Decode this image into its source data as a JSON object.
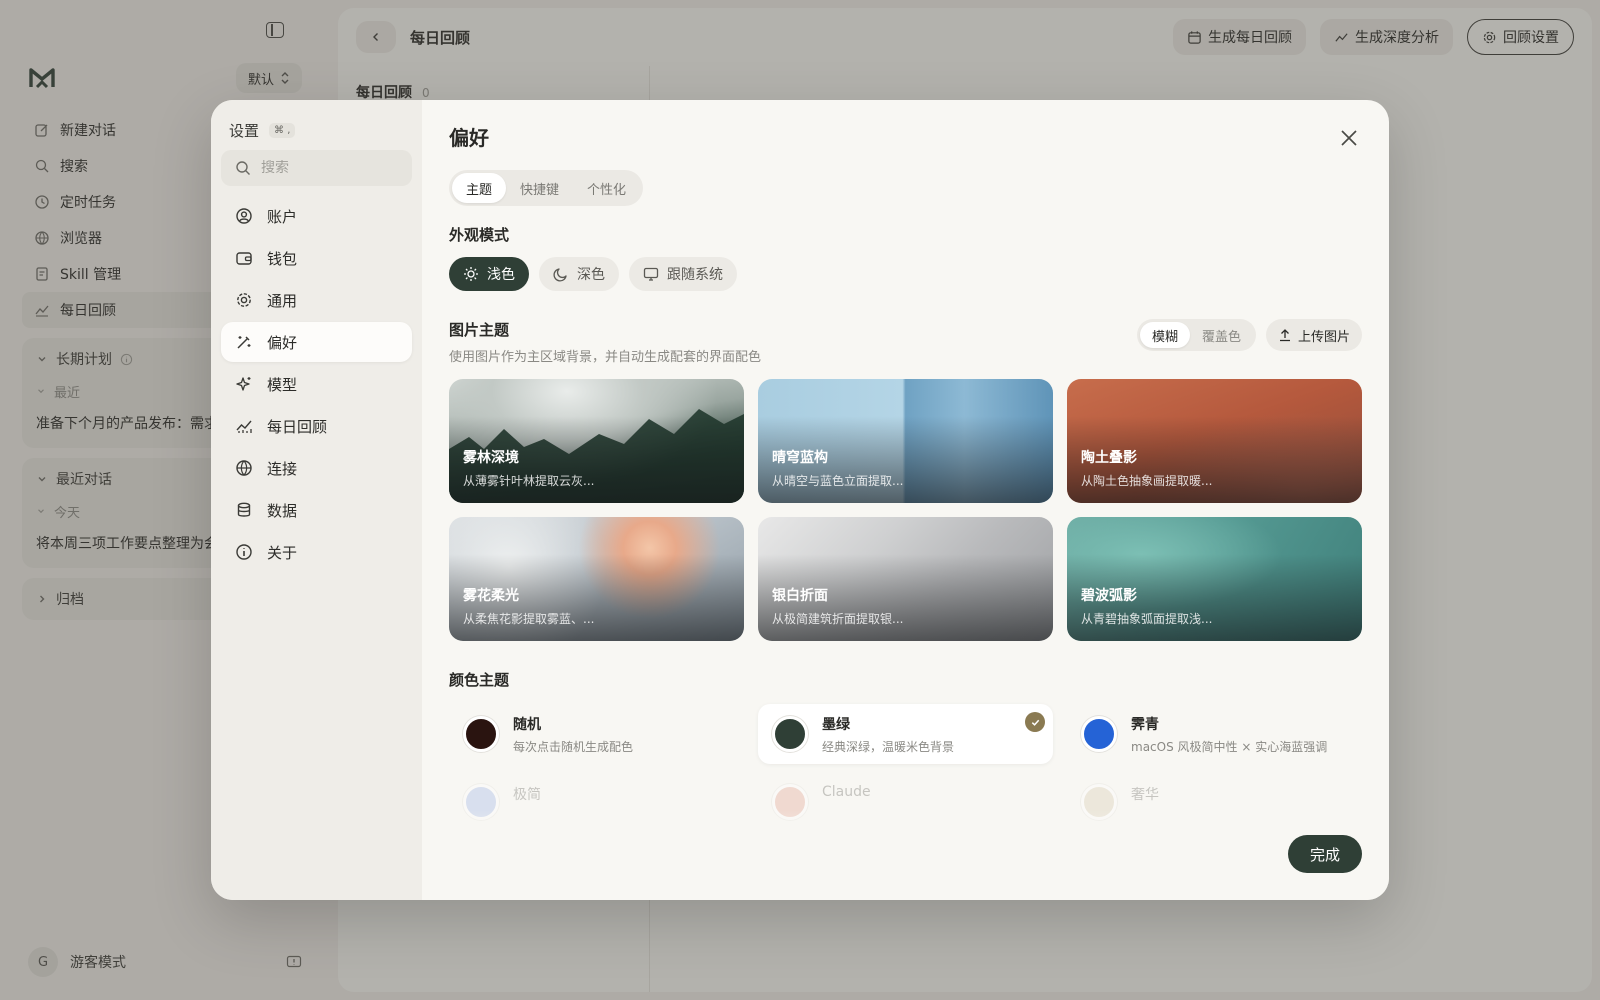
{
  "app": {
    "workspace_select": "默认",
    "nav": [
      {
        "label": "新建对话",
        "icon": "edit-icon"
      },
      {
        "label": "搜索",
        "icon": "search-icon"
      },
      {
        "label": "定时任务",
        "icon": "clock-icon"
      },
      {
        "label": "浏览器",
        "icon": "globe-icon"
      },
      {
        "label": "Skill 管理",
        "icon": "skill-icon"
      },
      {
        "label": "每日回顾",
        "icon": "chart-icon"
      }
    ],
    "sections": {
      "long_term": {
        "label": "长期计划",
        "sub": "最近",
        "item": "准备下个月的产品发布：需求"
      },
      "recent": {
        "label": "最近对话",
        "sub": "今天",
        "item": "将本周三项工作要点整理为会"
      },
      "archive": {
        "label": "归档"
      }
    },
    "footer": {
      "avatar": "G",
      "name": "游客模式"
    }
  },
  "main": {
    "title": "每日回顾",
    "buttons": {
      "generate_daily": "生成每日回顾",
      "generate_deep": "生成深度分析",
      "settings": "回顾设置"
    },
    "list_header": "每日回顾",
    "list_count": "0"
  },
  "modal": {
    "sidebar_title": "设置",
    "shortcut": "⌘ ,",
    "search_placeholder": "搜索",
    "nav": [
      {
        "label": "账户",
        "icon": "user-icon"
      },
      {
        "label": "钱包",
        "icon": "wallet-icon"
      },
      {
        "label": "通用",
        "icon": "gear-icon"
      },
      {
        "label": "偏好",
        "icon": "wand-icon"
      },
      {
        "label": "模型",
        "icon": "sparkle-icon"
      },
      {
        "label": "每日回顾",
        "icon": "chart-icon"
      },
      {
        "label": "连接",
        "icon": "globe-icon"
      },
      {
        "label": "数据",
        "icon": "database-icon"
      },
      {
        "label": "关于",
        "icon": "info-icon"
      }
    ],
    "active_nav": "偏好",
    "title": "偏好",
    "tabs": [
      "主题",
      "快捷键",
      "个性化"
    ],
    "active_tab": "主题",
    "appearance": {
      "label": "外观模式",
      "options": [
        "浅色",
        "深色",
        "跟随系统"
      ],
      "selected": "浅色"
    },
    "image_theme": {
      "label": "图片主题",
      "description": "使用图片作为主区域背景，并自动生成配套的界面配色",
      "modes": [
        "模糊",
        "覆盖色"
      ],
      "selected_mode": "模糊",
      "upload": "上传图片",
      "cards": [
        {
          "title": "雾林深境",
          "desc": "从薄雾针叶林提取云灰..."
        },
        {
          "title": "晴穹蓝构",
          "desc": "从晴空与蓝色立面提取..."
        },
        {
          "title": "陶土叠影",
          "desc": "从陶土色抽象画提取暖..."
        },
        {
          "title": "雾花柔光",
          "desc": "从柔焦花影提取雾蓝、..."
        },
        {
          "title": "银白折面",
          "desc": "从极简建筑折面提取银..."
        },
        {
          "title": "碧波弧影",
          "desc": "从青碧抽象弧面提取浅..."
        }
      ]
    },
    "color_theme": {
      "label": "颜色主题",
      "items": [
        {
          "name": "随机",
          "desc": "每次点击随机生成配色",
          "color": "#2a1410"
        },
        {
          "name": "墨绿",
          "desc": "经典深绿，温暖米色背景",
          "color": "#2f3f36"
        },
        {
          "name": "霁青",
          "desc": "macOS 风极简中性 × 实心海蓝强调",
          "color": "#2563d6"
        },
        {
          "name": "极简",
          "desc": "",
          "color": "#9db3e6"
        },
        {
          "name": "Claude",
          "desc": "",
          "color": "#e4a390"
        },
        {
          "name": "奢华",
          "desc": "",
          "color": "#d7ccb0"
        }
      ],
      "selected": "墨绿"
    },
    "done_button": "完成"
  },
  "colors": {
    "accent": "#2f3f36",
    "check": "#8a7a52"
  }
}
